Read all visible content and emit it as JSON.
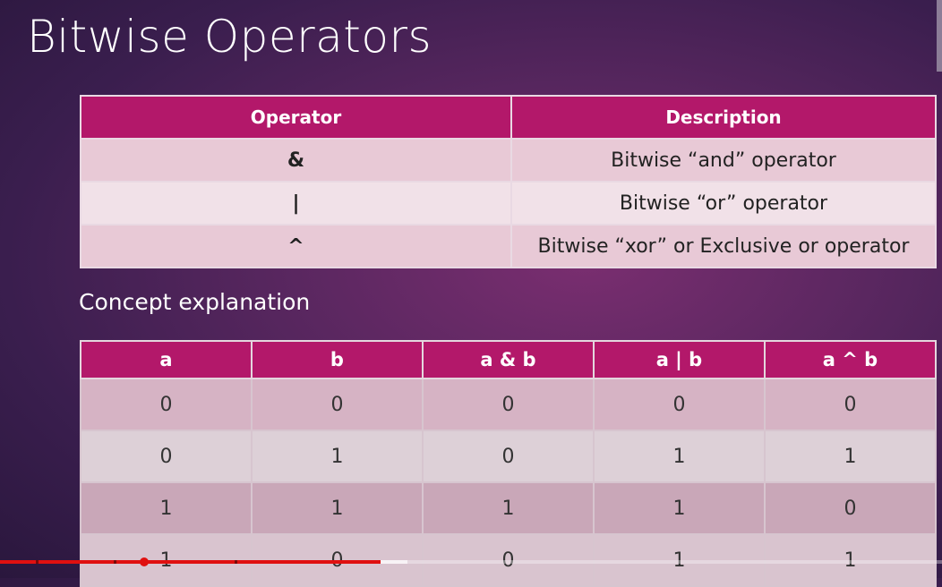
{
  "slide": {
    "title": "Bitwise Operators",
    "concept_heading": "Concept explanation"
  },
  "operators_table": {
    "headers": [
      "Operator",
      "Description"
    ],
    "rows": [
      {
        "operator": "&",
        "description": "Bitwise “and” operator"
      },
      {
        "operator": "|",
        "description": "Bitwise “or” operator"
      },
      {
        "operator": "^",
        "description": "Bitwise “xor” or Exclusive or operator"
      }
    ]
  },
  "truth_table": {
    "headers": [
      "a",
      "b",
      "a & b",
      "a | b",
      "a ^ b"
    ],
    "rows": [
      [
        "0",
        "0",
        "0",
        "0",
        "0"
      ],
      [
        "0",
        "1",
        "0",
        "1",
        "1"
      ],
      [
        "1",
        "1",
        "1",
        "1",
        "0"
      ],
      [
        "1",
        "0",
        "0",
        "1",
        "1"
      ]
    ]
  },
  "player": {
    "progress_fraction": 0.404,
    "accent_color": "#e01010"
  },
  "colors": {
    "header_bg": "#b3186a",
    "row_light": "#f1e1e8",
    "row_dark": "#e8c9d6"
  }
}
